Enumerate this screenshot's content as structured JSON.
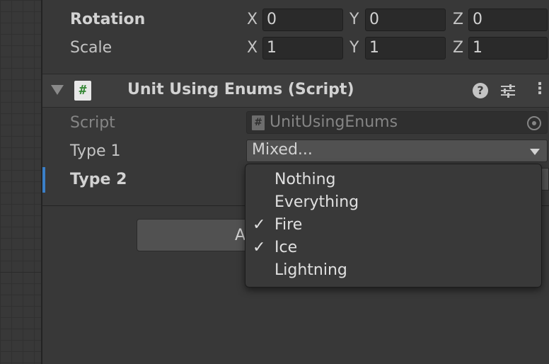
{
  "transform": {
    "rotation": {
      "label": "Rotation",
      "x_axis": "X",
      "x": "0",
      "y_axis": "Y",
      "y": "0",
      "z_axis": "Z",
      "z": "0"
    },
    "scale": {
      "label": "Scale",
      "x_axis": "X",
      "x": "1",
      "y_axis": "Y",
      "y": "1",
      "z_axis": "Z",
      "z": "1"
    }
  },
  "component": {
    "title": "Unit Using Enums (Script)",
    "icon": "script-hash-icon",
    "help_icon": "?",
    "settings_icon": "sliders-icon",
    "menu_icon": "⋮"
  },
  "fields": {
    "script": {
      "label": "Script",
      "icon_glyph": "#",
      "value": "UnitUsingEnums"
    },
    "type1": {
      "label": "Type 1",
      "value": "Mixed..."
    },
    "type2": {
      "label": "Type 2"
    }
  },
  "add_component": {
    "label_fragment": "A"
  },
  "dropdown_menu": {
    "check_glyph": "✓",
    "items": [
      {
        "label": "Nothing",
        "checked": false
      },
      {
        "label": "Everything",
        "checked": false
      },
      {
        "label": "Fire",
        "checked": true
      },
      {
        "label": "Ice",
        "checked": true
      },
      {
        "label": "Lightning",
        "checked": false
      }
    ]
  },
  "colors": {
    "accent": "#3a7fc8",
    "background": "#383838",
    "menu_bg": "#393939"
  }
}
